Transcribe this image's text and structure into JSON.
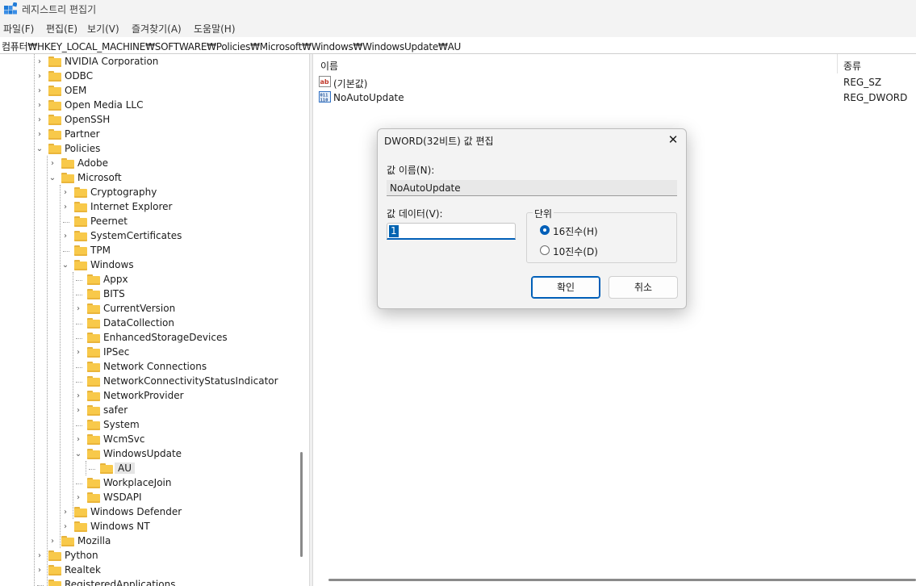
{
  "window": {
    "title": "레지스트리 편집기"
  },
  "menu": [
    "파일(F)",
    "편집(E)",
    "보기(V)",
    "즐겨찾기(A)",
    "도움말(H)"
  ],
  "address": "컴퓨터₩HKEY_LOCAL_MACHINE₩SOFTWARE₩Policies₩Microsoft₩Windows₩WindowsUpdate₩AU",
  "tree": [
    {
      "label": "NVIDIA Corporation",
      "arrow": "›"
    },
    {
      "label": "ODBC",
      "arrow": "›"
    },
    {
      "label": "OEM",
      "arrow": "›"
    },
    {
      "label": "Open Media LLC",
      "arrow": "›"
    },
    {
      "label": "OpenSSH",
      "arrow": "›"
    },
    {
      "label": "Partner",
      "arrow": "›"
    },
    {
      "label": "Policies",
      "arrow": "⌄"
    },
    {
      "label": "Adobe",
      "arrow": "›"
    },
    {
      "label": "Microsoft",
      "arrow": "⌄"
    },
    {
      "label": "Cryptography",
      "arrow": "›"
    },
    {
      "label": "Internet Explorer",
      "arrow": "›"
    },
    {
      "label": "Peernet",
      "arrow": ""
    },
    {
      "label": "SystemCertificates",
      "arrow": "›"
    },
    {
      "label": "TPM",
      "arrow": ""
    },
    {
      "label": "Windows",
      "arrow": "⌄"
    },
    {
      "label": "Appx",
      "arrow": ""
    },
    {
      "label": "BITS",
      "arrow": ""
    },
    {
      "label": "CurrentVersion",
      "arrow": "›"
    },
    {
      "label": "DataCollection",
      "arrow": ""
    },
    {
      "label": "EnhancedStorageDevices",
      "arrow": ""
    },
    {
      "label": "IPSec",
      "arrow": "›"
    },
    {
      "label": "Network Connections",
      "arrow": ""
    },
    {
      "label": "NetworkConnectivityStatusIndicator",
      "arrow": ""
    },
    {
      "label": "NetworkProvider",
      "arrow": "›"
    },
    {
      "label": "safer",
      "arrow": "›"
    },
    {
      "label": "System",
      "arrow": ""
    },
    {
      "label": "WcmSvc",
      "arrow": "›"
    },
    {
      "label": "WindowsUpdate",
      "arrow": "⌄"
    },
    {
      "label": "AU",
      "arrow": "",
      "selected": true
    },
    {
      "label": "WorkplaceJoin",
      "arrow": ""
    },
    {
      "label": "WSDAPI",
      "arrow": "›"
    },
    {
      "label": "Windows Defender",
      "arrow": "›"
    },
    {
      "label": "Windows NT",
      "arrow": "›"
    },
    {
      "label": "Mozilla",
      "arrow": "›"
    },
    {
      "label": "Python",
      "arrow": "›"
    },
    {
      "label": "Realtek",
      "arrow": "›"
    },
    {
      "label": "RegisteredApplications",
      "arrow": ""
    }
  ],
  "list": {
    "columns": {
      "name": "이름",
      "type": "종류"
    },
    "rows": [
      {
        "name": "(기본값)",
        "type": "REG_SZ",
        "icon": "string-value-icon"
      },
      {
        "name": "NoAutoUpdate",
        "type": "REG_DWORD",
        "icon": "binary-value-icon"
      }
    ]
  },
  "dialog": {
    "title": "DWORD(32비트) 값 편집",
    "close_glyph": "✕",
    "name_label": "값 이름(N):",
    "name_value": "NoAutoUpdate",
    "data_label": "값 데이터(V):",
    "data_value": "1",
    "base_label": "단위",
    "hex_label": "16진수(H)",
    "dec_label": "10진수(D)",
    "hex_selected": true,
    "ok_label": "확인",
    "cancel_label": "취소"
  },
  "colors": {
    "accent": "#005fb8",
    "folder": "#f8c94a"
  }
}
